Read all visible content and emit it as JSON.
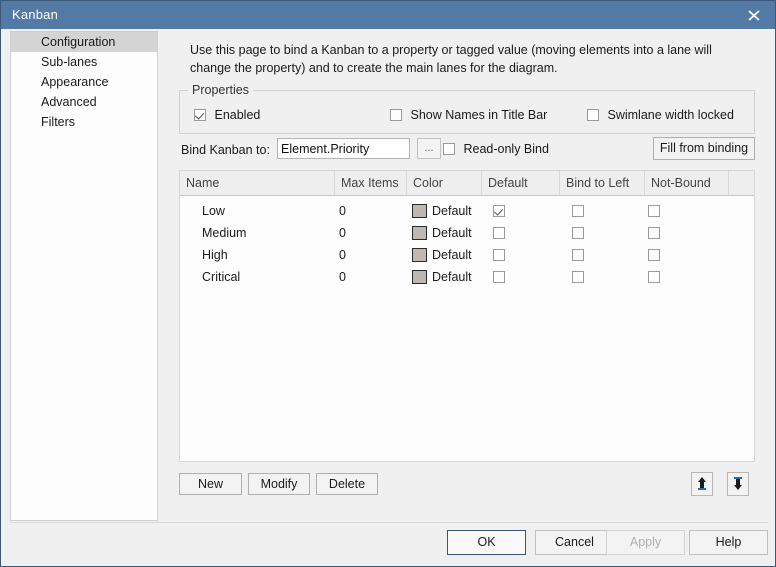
{
  "window": {
    "title": "Kanban",
    "close_icon": "close-icon"
  },
  "sidebar": {
    "items": [
      {
        "label": "Configuration",
        "selected": true
      },
      {
        "label": "Sub-lanes",
        "selected": false
      },
      {
        "label": "Appearance",
        "selected": false
      },
      {
        "label": "Advanced",
        "selected": false
      },
      {
        "label": "Filters",
        "selected": false
      }
    ]
  },
  "main": {
    "intro_line1": "Use this page to bind a Kanban to a property or tagged value (moving elements into a lane will",
    "intro_line2": "change the property) and to create the main lanes for the diagram.",
    "properties_group": {
      "title": "Properties",
      "options": [
        {
          "label": "Enabled",
          "checked": true
        },
        {
          "label": "Show Names in Title Bar",
          "checked": false
        },
        {
          "label": "Swimlane width locked",
          "checked": false
        }
      ]
    },
    "bind": {
      "label": "Bind Kanban to:",
      "value": "Element.Priority",
      "placeholder": "",
      "browse_label": "...",
      "readonly_label": "Read-only Bind",
      "readonly_checked": false,
      "fill_label": "Fill from binding"
    },
    "grid": {
      "columns": [
        "Name",
        "Max Items",
        "Color",
        "Default",
        "Bind to Left",
        "Not-Bound"
      ],
      "rows": [
        {
          "name": "Low",
          "max_items": "0",
          "color": "Default",
          "color_hex": "#c0b8b0",
          "default": true,
          "bind_to_left": false,
          "not_bound": false
        },
        {
          "name": "Medium",
          "max_items": "0",
          "color": "Default",
          "color_hex": "#c0b8b0",
          "default": false,
          "bind_to_left": false,
          "not_bound": false
        },
        {
          "name": "High",
          "max_items": "0",
          "color": "Default",
          "color_hex": "#c0b8b0",
          "default": false,
          "bind_to_left": false,
          "not_bound": false
        },
        {
          "name": "Critical",
          "max_items": "0",
          "color": "Default",
          "color_hex": "#c0b8b0",
          "default": false,
          "bind_to_left": false,
          "not_bound": false
        }
      ]
    },
    "list_buttons": {
      "new_label": "New",
      "modify_label": "Modify",
      "delete_label": "Delete",
      "move_up_icon": "move-up-icon",
      "move_down_icon": "move-down-icon"
    }
  },
  "footer": {
    "ok_label": "OK",
    "cancel_label": "Cancel",
    "apply_label": "Apply",
    "help_label": "Help",
    "apply_disabled": true
  }
}
